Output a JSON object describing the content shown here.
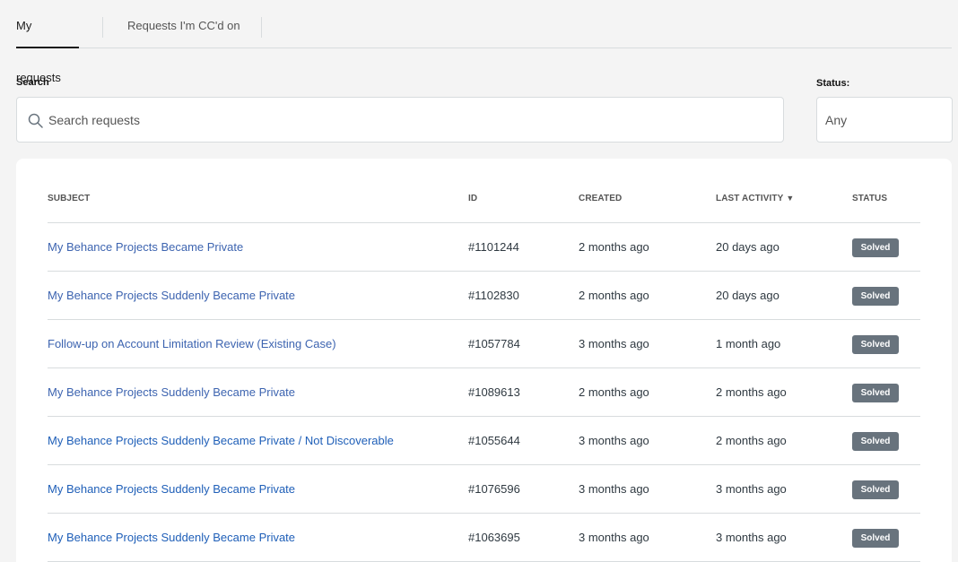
{
  "tabs": [
    {
      "label": "My requests",
      "active": true
    },
    {
      "label": "Requests I'm CC'd on",
      "active": false
    }
  ],
  "filters": {
    "search_label": "Search",
    "search_placeholder": "Search requests",
    "status_label": "Status:",
    "status_value": "Any"
  },
  "table": {
    "headers": {
      "subject": "SUBJECT",
      "id": "ID",
      "created": "CREATED",
      "last_activity": "LAST ACTIVITY",
      "sort_indicator": "▼",
      "status": "STATUS"
    },
    "rows": [
      {
        "subject": "My Behance Projects Became Private",
        "id": "#1101244",
        "created": "2 months ago",
        "last_activity": "20 days ago",
        "status": "Solved"
      },
      {
        "subject": "My Behance Projects Suddenly Became Private",
        "id": "#1102830",
        "created": "2 months ago",
        "last_activity": "20 days ago",
        "status": "Solved"
      },
      {
        "subject": "Follow-up on Account Limitation Review (Existing Case)",
        "id": "#1057784",
        "created": "3 months ago",
        "last_activity": "1 month ago",
        "status": "Solved"
      },
      {
        "subject": "My Behance Projects Suddenly Became Private",
        "id": "#1089613",
        "created": "2 months ago",
        "last_activity": "2 months ago",
        "status": "Solved"
      },
      {
        "subject": "My Behance Projects Suddenly Became Private / Not Discoverable",
        "id": "#1055644",
        "created": "3 months ago",
        "last_activity": "2 months ago",
        "status": "Solved"
      },
      {
        "subject": "My Behance Projects Suddenly Became Private",
        "id": "#1076596",
        "created": "3 months ago",
        "last_activity": "3 months ago",
        "status": "Solved"
      },
      {
        "subject": "My Behance Projects Suddenly Became Private",
        "id": "#1063695",
        "created": "3 months ago",
        "last_activity": "3 months ago",
        "status": "Solved"
      }
    ]
  },
  "colors": {
    "link": "#3d64b0",
    "badge": "#68737d",
    "border": "#d8dcde"
  }
}
